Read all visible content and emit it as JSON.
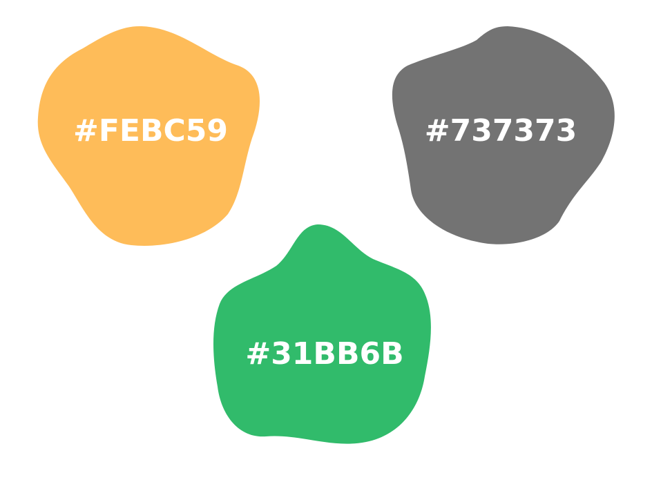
{
  "swatches": [
    {
      "label": "#FEBC59",
      "color": "#FEBC59"
    },
    {
      "label": "#737373",
      "color": "#737373"
    },
    {
      "label": "#31BB6B",
      "color": "#31BB6B"
    }
  ]
}
